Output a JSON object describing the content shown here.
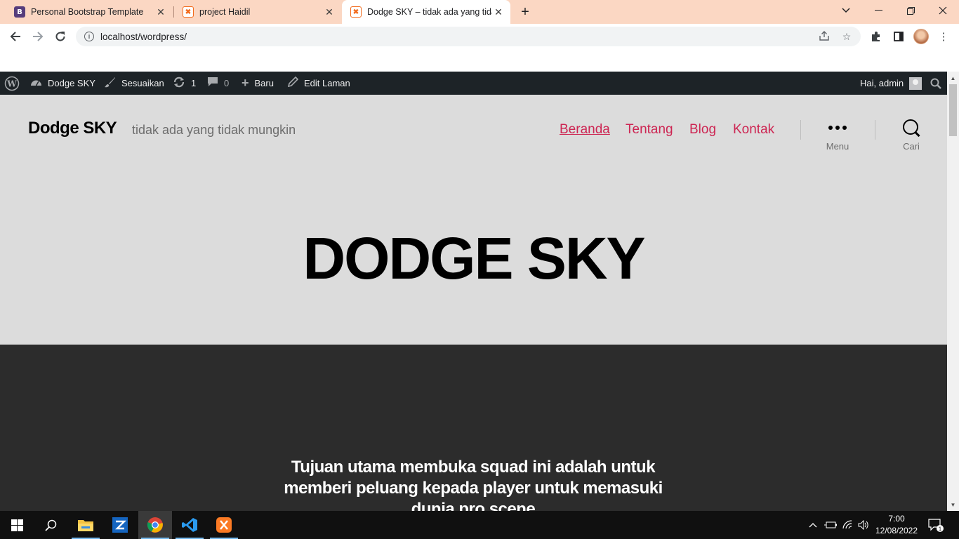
{
  "browser": {
    "tabs": [
      {
        "title": "Personal Bootstrap Template",
        "favicon": "bootstrap-icon",
        "active": false
      },
      {
        "title": "project Haidil",
        "favicon": "xampp-icon",
        "active": false
      },
      {
        "title": "Dodge SKY – tidak ada yang tidak mungkin",
        "favicon": "xampp-icon",
        "active": true
      }
    ],
    "url": "localhost/wordpress/"
  },
  "admin_bar": {
    "site_name": "Dodge SKY",
    "customize": "Sesuaikan",
    "updates_count": "1",
    "comments_count": "0",
    "new_label": "Baru",
    "edit_label": "Edit Laman",
    "greeting": "Hai, admin"
  },
  "site": {
    "title": "Dodge SKY",
    "tagline": "tidak ada yang tidak mungkin",
    "nav": [
      "Beranda",
      "Tentang",
      "Blog",
      "Kontak"
    ],
    "menu_label": "Menu",
    "search_label": "Cari",
    "hero_title": "DODGE SKY",
    "intro_text": "Tujuan utama membuka squad ini adalah untuk memberi peluang kepada player untuk memasuki dunia pro scene"
  },
  "taskbar": {
    "time": "7:00",
    "date": "12/08/2022",
    "notification_count": "1"
  },
  "colors": {
    "tabstrip": "#fbd7c3",
    "accent": "#cd2653",
    "admin_bar": "#1d2327",
    "header_bg": "#dcdcdc",
    "dark_section": "#2c2c2c"
  }
}
